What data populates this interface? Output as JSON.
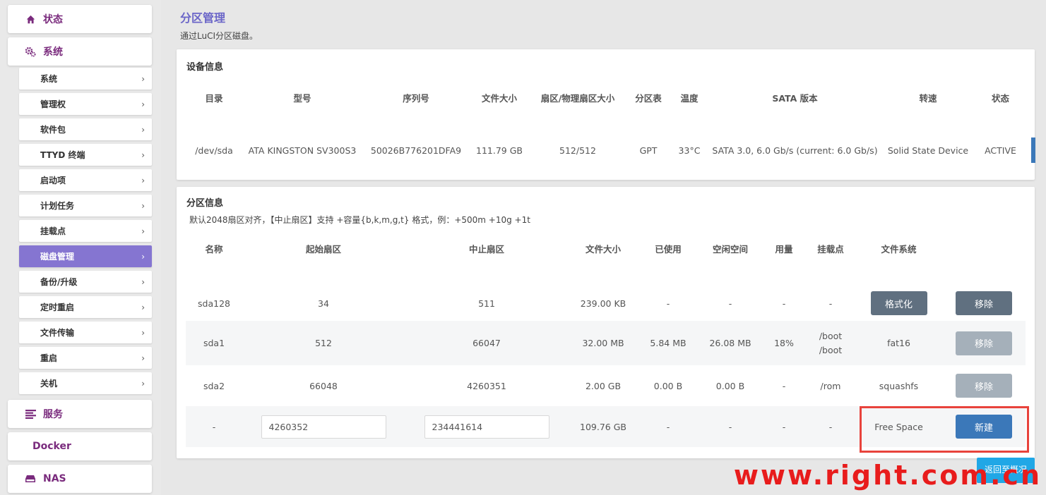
{
  "sidebar": {
    "top_items": [
      {
        "label": "状态",
        "icon": "home-icon"
      },
      {
        "label": "系统",
        "icon": "gears-icon"
      },
      {
        "label": "服务",
        "icon": "list-icon"
      },
      {
        "label": "Docker",
        "icon": ""
      },
      {
        "label": "NAS",
        "icon": "drive-icon"
      }
    ],
    "sub_items": [
      {
        "label": "系统"
      },
      {
        "label": "管理权"
      },
      {
        "label": "软件包"
      },
      {
        "label": "TTYD 终端"
      },
      {
        "label": "启动项"
      },
      {
        "label": "计划任务"
      },
      {
        "label": "挂载点"
      },
      {
        "label": "磁盘管理"
      },
      {
        "label": "备份/升级"
      },
      {
        "label": "定时重启"
      },
      {
        "label": "文件传输"
      },
      {
        "label": "重启"
      },
      {
        "label": "关机"
      }
    ],
    "chevron": "›",
    "active_sub": "磁盘管理"
  },
  "page": {
    "title": "分区管理",
    "description": "通过LuCI分区磁盘。"
  },
  "device_info": {
    "title": "设备信息",
    "headers": [
      "目录",
      "型号",
      "序列号",
      "文件大小",
      "扇区/物理扇区大小",
      "分区表",
      "温度",
      "SATA 版本",
      "转速",
      "状态"
    ],
    "row": [
      "/dev/sda",
      "ATA KINGSTON SV300S3",
      "50026B776201DFA9",
      "111.79 GB",
      "512/512",
      "GPT",
      "33°C",
      "SATA 3.0, 6.0 Gb/s (current: 6.0 Gb/s)",
      "Solid State Device",
      "ACTIVE"
    ]
  },
  "partition_info": {
    "title": "分区信息",
    "note": "默认2048扇区对齐，【中止扇区】支持 +容量{b,k,m,g,t} 格式，例：+500m +10g +1t",
    "headers": [
      "名称",
      "起始扇区",
      "中止扇区",
      "文件大小",
      "已使用",
      "空闲空间",
      "用量",
      "挂载点",
      "文件系统"
    ],
    "rows": [
      {
        "name": "sda128",
        "start": "34",
        "end": "511",
        "size": "239.00 KB",
        "used": "-",
        "free": "-",
        "usage": "-",
        "mount": "-",
        "fs_button": "格式化",
        "action": "移除"
      },
      {
        "name": "sda1",
        "start": "512",
        "end": "66047",
        "size": "32.00 MB",
        "used": "5.84 MB",
        "free": "26.08 MB",
        "usage": "18%",
        "mount1": "/boot",
        "mount2": "/boot",
        "fs": "fat16",
        "action": "移除"
      },
      {
        "name": "sda2",
        "start": "66048",
        "end": "4260351",
        "size": "2.00 GB",
        "used": "0.00 B",
        "free": "0.00 B",
        "usage": "-",
        "mount": "/rom",
        "fs": "squashfs",
        "action": "移除"
      },
      {
        "name": "-",
        "start_value": "4260352",
        "end_value": "234441614",
        "size": "109.76 GB",
        "used": "-",
        "free": "-",
        "usage": "-",
        "mount": "-",
        "fs": "Free Space",
        "action": "新建"
      }
    ]
  },
  "back_button": "返回至概况",
  "watermark": "www.right.com.cn"
}
